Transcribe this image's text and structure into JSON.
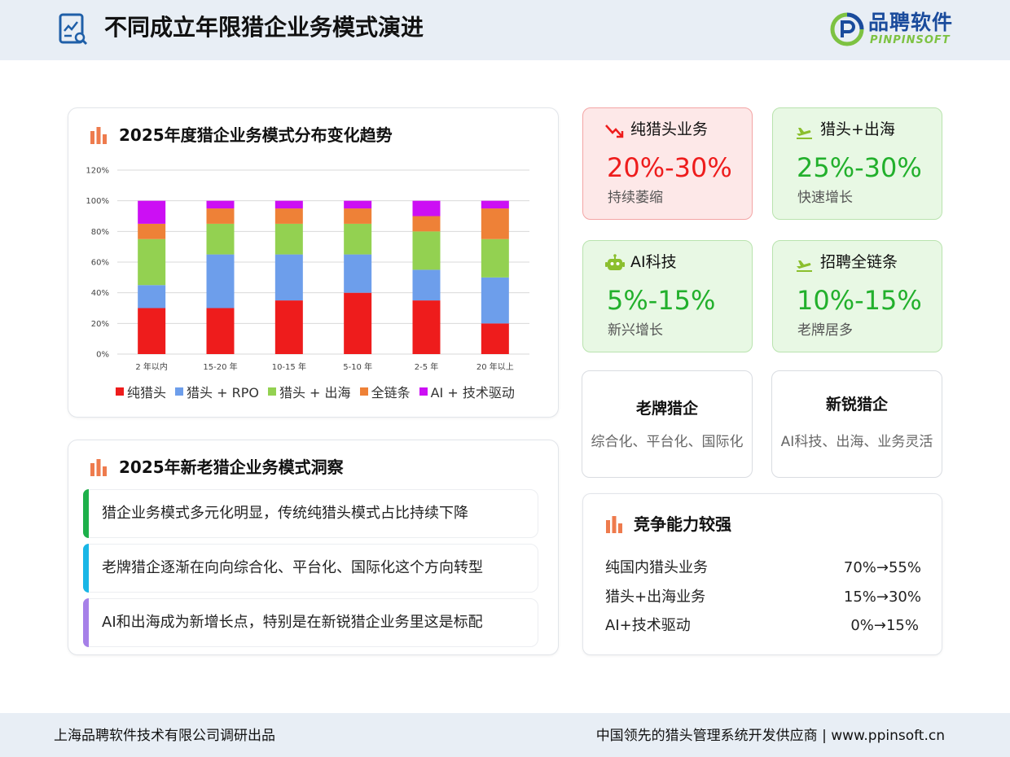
{
  "header": {
    "title": "不同成立年限猎企业务模式演进",
    "logo_cn": "品聘软件",
    "logo_en": "PINPINSOFT"
  },
  "chart_section": {
    "title": "2025年度猎企业务模式分布变化趋势"
  },
  "chart_data": {
    "type": "bar",
    "stacked": true,
    "categories": [
      "2 年以内",
      "15-20 年",
      "10-15 年",
      "5-10 年",
      "2-5 年",
      "20 年以上"
    ],
    "series": [
      {
        "name": "纯猎头",
        "color": "#ee1c1c",
        "values": [
          30,
          30,
          35,
          40,
          35,
          20
        ]
      },
      {
        "name": "猎头 + RPO",
        "color": "#6d9eeb",
        "values": [
          15,
          35,
          30,
          25,
          20,
          30
        ]
      },
      {
        "name": "猎头 + 出海",
        "color": "#93d151",
        "values": [
          30,
          20,
          20,
          20,
          25,
          25
        ]
      },
      {
        "name": "全链条",
        "color": "#ee8137",
        "values": [
          10,
          10,
          10,
          10,
          10,
          20
        ]
      },
      {
        "name": "AI + 技术驱动",
        "color": "#cc0ff4",
        "values": [
          15,
          5,
          5,
          5,
          10,
          5
        ]
      }
    ],
    "y_ticks": [
      "0%",
      "20%",
      "40%",
      "60%",
      "80%",
      "100%",
      "120%"
    ],
    "ylim": [
      0,
      120
    ],
    "grid": true,
    "legend_position": "bottom"
  },
  "insight_section": {
    "title": "2025年新老猎企业务模式洞察",
    "items": [
      {
        "text": "猎企业务模式多元化明显，传统纯猎头模式占比持续下降",
        "color": "#1db04a"
      },
      {
        "text": "老牌猎企逐渐在向向综合化、平台化、国际化这个方向转型",
        "color": "#19b6e6"
      },
      {
        "text": "AI和出海成为新增长点，特别是在新锐猎企业务里这是标配",
        "color": "#a680e8"
      }
    ]
  },
  "stats": [
    {
      "label": "纯猎头业务",
      "value": "20%-30%",
      "note": "持续萎缩",
      "icon": "trend-down-icon"
    },
    {
      "label": "猎头+出海",
      "value": "25%-30%",
      "note": "快速增长",
      "icon": "plane-takeoff-icon"
    },
    {
      "label": "AI科技",
      "value": "5%-15%",
      "note": "新兴增长",
      "icon": "robot-icon"
    },
    {
      "label": "招聘全链条",
      "value": "10%-15%",
      "note": "老牌居多",
      "icon": "plane-takeoff-icon"
    }
  ],
  "types": [
    {
      "title": "老牌猎企",
      "desc": "综合化、平台化、国际化"
    },
    {
      "title": "新锐猎企",
      "desc": "AI科技、出海、业务灵活"
    }
  ],
  "competition": {
    "title": "竞争能力较强",
    "rows": [
      {
        "label": "纯国内猎头业务",
        "value": "70%→55%"
      },
      {
        "label": "猎头+出海业务",
        "value": "15%→30%"
      },
      {
        "label": "AI+技术驱动",
        "value": "0%→15%"
      }
    ]
  },
  "footer": {
    "left": "上海品聘软件技术有限公司调研出品",
    "right": "中国领先的猎头管理系统开发供应商 | www.ppinsoft.cn"
  },
  "colors": {
    "accent_orange": "#ee7b4d",
    "stat_red": "#ee1c1c",
    "stat_green": "#22b02c",
    "header_bg": "#e8eef5"
  }
}
